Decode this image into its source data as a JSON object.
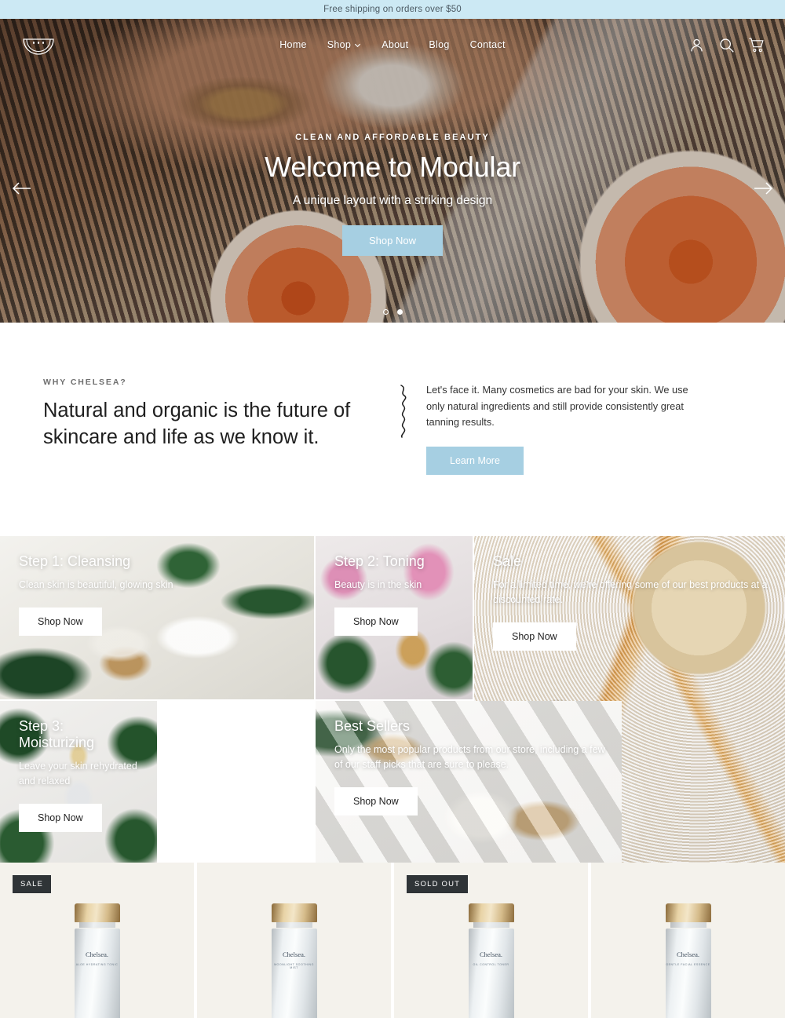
{
  "announcement": {
    "text": "Free shipping on orders over $50"
  },
  "header": {
    "logo_name": "watermelon-logo",
    "nav": [
      {
        "label": "Home",
        "has_dropdown": false
      },
      {
        "label": "Shop",
        "has_dropdown": true
      },
      {
        "label": "About",
        "has_dropdown": false
      },
      {
        "label": "Blog",
        "has_dropdown": false
      },
      {
        "label": "Contact",
        "has_dropdown": false
      }
    ],
    "icons": [
      "account-icon",
      "search-icon",
      "cart-icon"
    ]
  },
  "hero": {
    "eyebrow": "CLEAN AND AFFORDABLE BEAUTY",
    "title": "Welcome to Modular",
    "subtitle": "A unique layout with a striking design",
    "cta": "Shop Now",
    "prev_label": "Previous slide",
    "next_label": "Next slide",
    "slides": 2,
    "active_slide": 2,
    "button_color": "#a6cfe2"
  },
  "why": {
    "eyebrow": "WHY CHELSEA?",
    "heading": "Natural and organic is the future of skincare and life as we know it.",
    "body": "Let's face it. Many cosmetics are bad for your skin. We use only natural ingredients and still provide consistently great tanning results.",
    "cta": "Learn More"
  },
  "collections": [
    {
      "title": "Step 1: Cleansing",
      "desc": "Clean skin is beautiful, glowing skin",
      "cta": "Shop Now"
    },
    {
      "title": "Step 2: Toning",
      "desc": "Beauty is in the skin",
      "cta": "Shop Now"
    },
    {
      "title": "Sale",
      "desc": "For a limited time, we're offering some of our best products at a discounted rate.",
      "cta": "Shop Now"
    },
    {
      "title": "Step 3: Moisturizing",
      "desc": "Leave your skin rehydrated and relaxed",
      "cta": "Shop Now"
    },
    {
      "title": "Best Sellers",
      "desc": "Only the most popular products from our store, including a few of our staff picks that are sure to please.",
      "cta": "Shop Now"
    }
  ],
  "products": [
    {
      "badge": "SALE",
      "brand": "Chelsea.",
      "name": "ALOE HYDRATING TONIC"
    },
    {
      "badge": "",
      "brand": "Chelsea.",
      "name": "MOONLIGHT SOOTHING MIST"
    },
    {
      "badge": "SOLD OUT",
      "brand": "Chelsea.",
      "name": "OIL CONTROL TONER"
    },
    {
      "badge": "",
      "brand": "Chelsea.",
      "name": "GENTLE FACIAL ESSENCE"
    }
  ],
  "colors": {
    "accent": "#a6cfe2",
    "announce_bg": "#cce9f4",
    "badge_bg": "#2f3437",
    "product_bg": "#f4f2ec"
  }
}
